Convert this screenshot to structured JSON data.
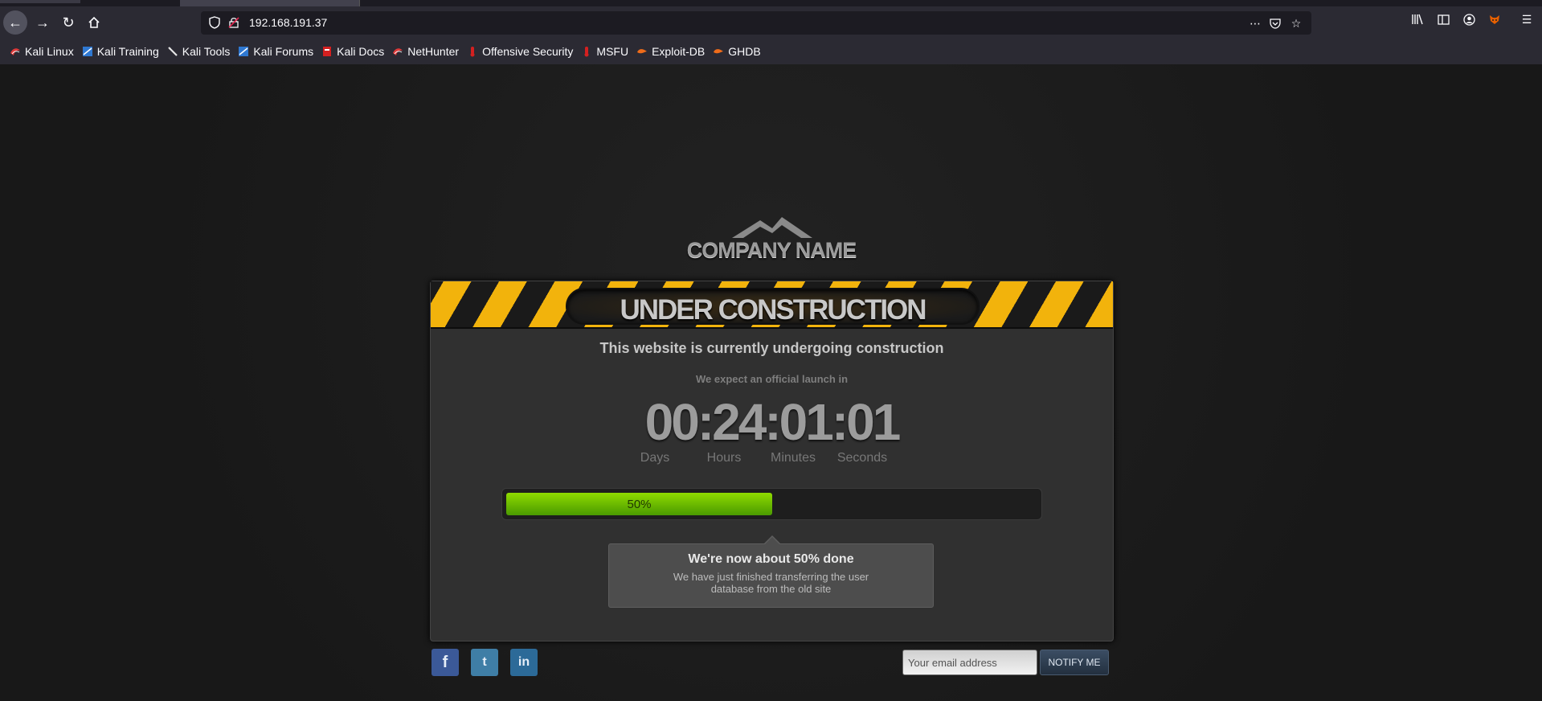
{
  "browser": {
    "url": "192.168.191.37",
    "bookmarks": [
      {
        "label": "Kali Linux",
        "icon": "kali-dragon-icon"
      },
      {
        "label": "Kali Training",
        "icon": "kali-training-icon"
      },
      {
        "label": "Kali Tools",
        "icon": "kali-tools-icon"
      },
      {
        "label": "Kali Forums",
        "icon": "kali-forums-icon"
      },
      {
        "label": "Kali Docs",
        "icon": "kali-docs-icon"
      },
      {
        "label": "NetHunter",
        "icon": "nethunter-icon"
      },
      {
        "label": "Offensive Security",
        "icon": "offsec-icon"
      },
      {
        "label": "MSFU",
        "icon": "msfu-icon"
      },
      {
        "label": "Exploit-DB",
        "icon": "exploit-db-icon"
      },
      {
        "label": "GHDB",
        "icon": "ghdb-icon"
      }
    ]
  },
  "page": {
    "company_name": "COMPANY NAME",
    "banner": "UNDER CONSTRUCTION",
    "headline": "This website is currently undergoing construction",
    "subline": "We expect an official launch in",
    "countdown": {
      "display": "00:24:01:01",
      "labels": [
        "Days",
        "Hours",
        "Minutes",
        "Seconds"
      ]
    },
    "progress": {
      "label": "50%",
      "value": 0.5
    },
    "tooltip": {
      "title": "We're now about 50% done",
      "body": "We have just finished transferring the user database from the old site"
    },
    "social": [
      "facebook-icon",
      "twitter-icon",
      "linkedin-icon"
    ],
    "email": {
      "placeholder": "Your email address",
      "button": "NOTIFY ME"
    }
  },
  "colors": {
    "accent_green": "#6fc000",
    "stripe_yellow": "#f2b30c",
    "chrome_bg": "#2b2a33"
  }
}
